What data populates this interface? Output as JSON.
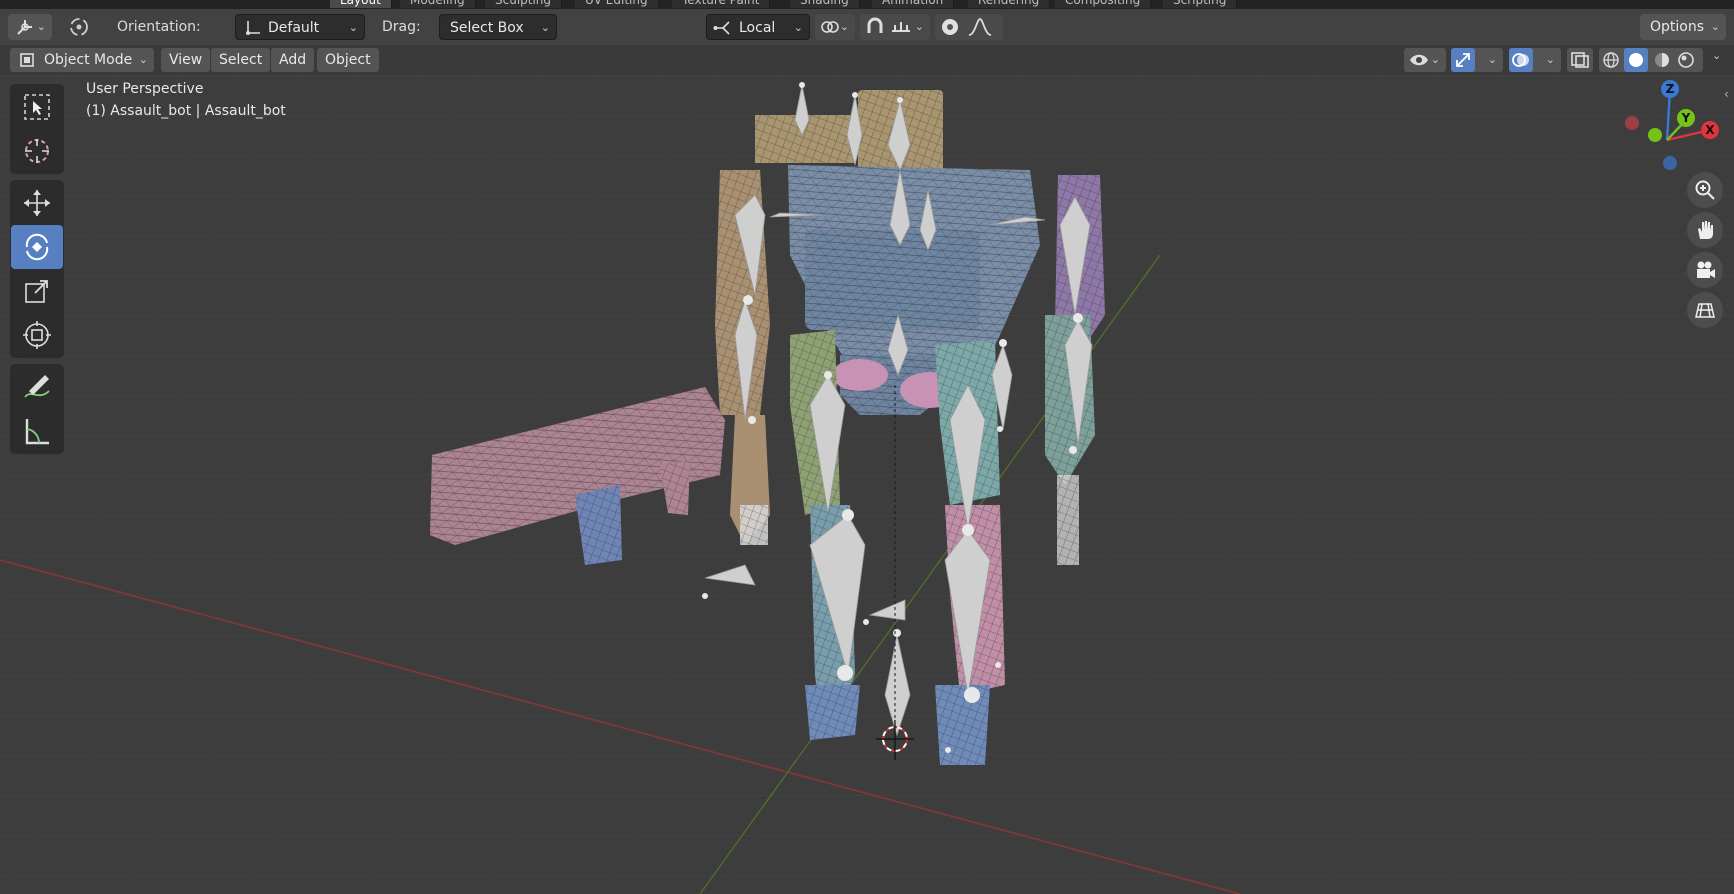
{
  "workspace_tabs": [
    "Layout",
    "Modeling",
    "Sculpting",
    "UV Editing",
    "Texture Paint",
    "Shading",
    "Animation",
    "Rendering",
    "Compositing",
    "Scripting"
  ],
  "header": {
    "orientation_label": "Orientation:",
    "orientation_value": "Default",
    "drag_label": "Drag:",
    "drag_value": "Select Box",
    "transform_pivot": "Local",
    "options_label": "Options"
  },
  "view_header": {
    "mode": "Object Mode",
    "menus": [
      "View",
      "Select",
      "Add",
      "Object"
    ]
  },
  "viewport": {
    "perspective_label": "User Perspective",
    "object_label": "(1) Assault_bot | Assault_bot"
  },
  "gizmo": {
    "x": "X",
    "y": "Y",
    "z": "Z"
  },
  "colors": {
    "accent": "#5680c2",
    "background": "#3d3d3d",
    "x_axis": "#e0353f",
    "y_axis": "#74c318",
    "z_axis": "#3779d4"
  },
  "icons": {
    "tools": [
      "select-box-icon",
      "cursor-icon",
      "move-icon",
      "rotate-icon",
      "scale-icon",
      "transform-icon",
      "annotate-icon",
      "measure-icon"
    ],
    "nav": [
      "zoom-icon",
      "pan-hand-icon",
      "camera-icon",
      "grid-icon"
    ]
  }
}
